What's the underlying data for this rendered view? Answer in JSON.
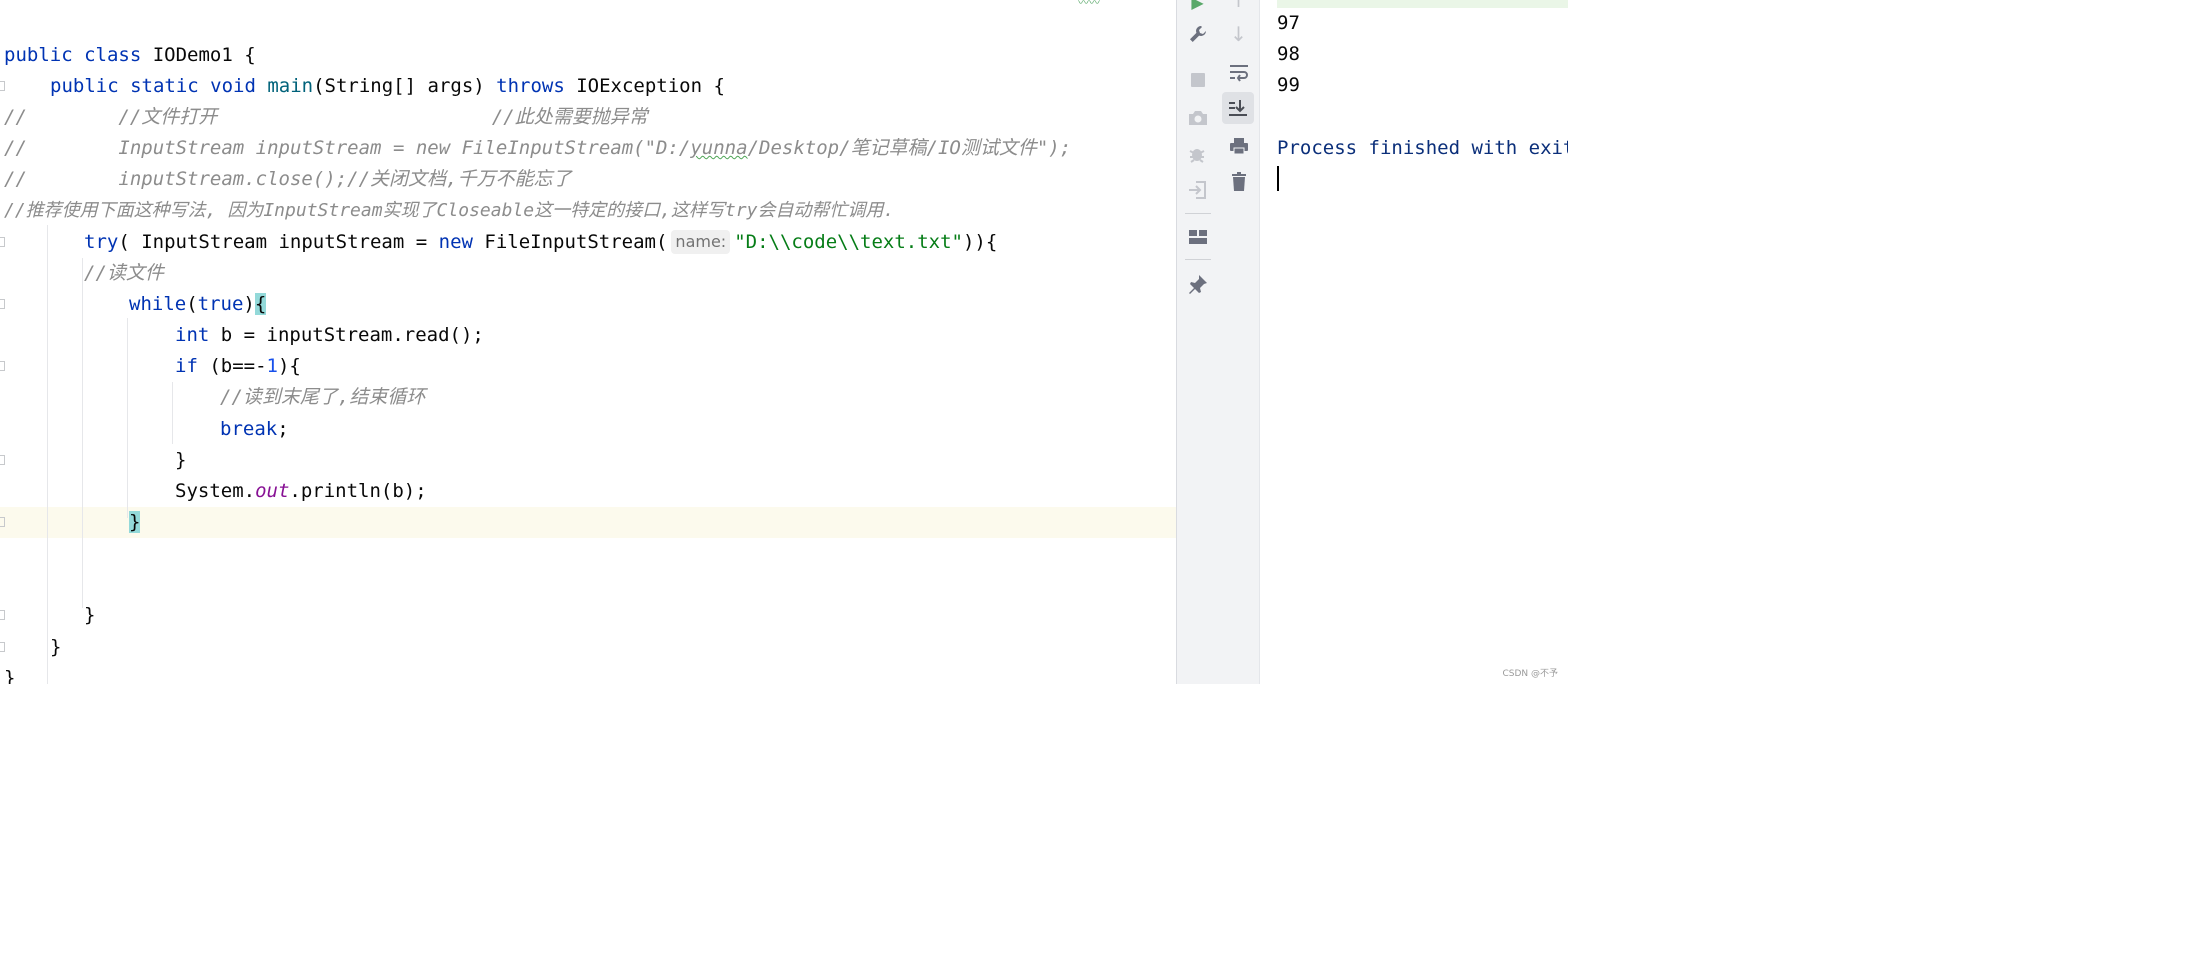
{
  "editor": {
    "lines": {
      "class_decl": {
        "kw": "public class ",
        "name": "IODemo1 {"
      },
      "main_decl": {
        "kw1": "public static void ",
        "fn": "main",
        "mid": "(String[] args) ",
        "kw2": "throws",
        "tail": " IOException {"
      },
      "c1": {
        "prefix": "//",
        "body": "        //文件打开                        //此处需要抛异常"
      },
      "c2": {
        "prefix": "//",
        "body1": "        InputStream inputStream = new FileInputStream(\"D:/",
        "sq": "yunna",
        "body2": "/Desktop/笔记草稿/IO测试文件\");"
      },
      "c3": {
        "prefix": "//",
        "body": "        inputStream.close();//关闭文档,千万不能忘了"
      },
      "c4": {
        "text": "//推荐使用下面这种写法, 因为InputStream实现了Closeable这一特定的接口,这样写try会自动帮忙调用."
      },
      "try_line": {
        "kw": "try",
        "p1": "( InputStream inputStream = ",
        "kw_new": "new",
        "p2": " FileInputStream(",
        "hint": "name:",
        "str": "\"D:\\\\code\\\\text.txt\"",
        "tail": ")){"
      },
      "read_cmt": {
        "text": "//读文件"
      },
      "while_line": {
        "kw": "while",
        "p1": "(",
        "kw_true": "true",
        "p2": ")",
        "brace": "{"
      },
      "int_line": {
        "kw": "int",
        "rest": " b = inputStream.read();"
      },
      "if_line": {
        "kw": "if",
        "p1": " (b==-",
        "num": "1",
        "p2": "){"
      },
      "end_cmt": {
        "text": "//读到末尾了,结束循环"
      },
      "break_line": {
        "kw": "break",
        "tail": ";"
      },
      "close_if": {
        "text": "}"
      },
      "println_line": {
        "p1": "System.",
        "field": "out",
        "p2": ".println(b);"
      },
      "close_while": {
        "text": "}"
      },
      "close_try": {
        "text": "}"
      },
      "close_main": {
        "text": "}"
      },
      "close_class": {
        "text": "}"
      }
    }
  },
  "toolbar_left": {
    "icons": [
      "run-icon",
      "wrench-icon",
      "stop-icon",
      "camera-icon",
      "debug-bug-icon",
      "login-icon",
      "layout-icon",
      "pin-icon"
    ]
  },
  "toolbar_right": {
    "icons": [
      "up-arrow-icon",
      "down-arrow-icon",
      "soft-wrap-icon",
      "scroll-to-end-icon",
      "print-icon",
      "trash-icon"
    ]
  },
  "console": {
    "outputs": [
      "97",
      "98",
      "99"
    ],
    "process_line": "Process finished with exit"
  },
  "watermark": "CSDN @不予"
}
